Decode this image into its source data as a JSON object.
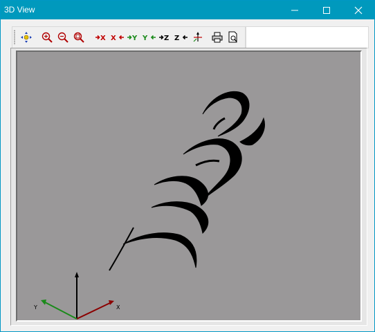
{
  "window": {
    "title": "3D View"
  },
  "toolbar": {
    "buttons": [
      {
        "icon": "pan-icon"
      },
      {
        "icon": "zoom-in-icon"
      },
      {
        "icon": "zoom-out-icon"
      },
      {
        "icon": "zoom-fit-icon"
      },
      {
        "icon": "view-plus-x-icon",
        "label": "X"
      },
      {
        "icon": "view-minus-x-icon",
        "label": "X"
      },
      {
        "icon": "view-plus-y-icon",
        "label": "Y"
      },
      {
        "icon": "view-minus-y-icon",
        "label": "Y"
      },
      {
        "icon": "view-plus-z-icon",
        "label": "Z"
      },
      {
        "icon": "view-minus-z-icon",
        "label": "Z"
      },
      {
        "icon": "rotate-axes-icon"
      },
      {
        "icon": "print-icon"
      },
      {
        "icon": "print-preview-icon"
      }
    ]
  },
  "axes": {
    "x_label": "X",
    "y_label": "Y",
    "x_color": "#8b0000",
    "y_color": "#1a8a1a",
    "z_color": "#000000"
  },
  "colors": {
    "titlebar": "#0099bd",
    "viewport_bg": "#9a9899"
  }
}
